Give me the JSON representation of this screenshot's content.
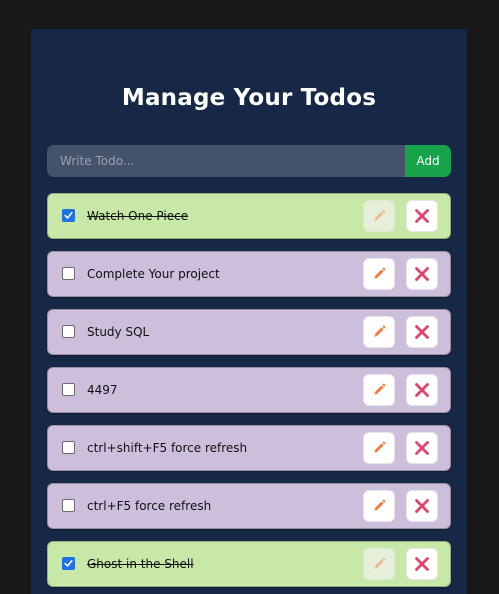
{
  "app": {
    "title": "Manage Your Todos"
  },
  "form": {
    "placeholder": "Write Todo...",
    "value": "",
    "add_label": "Add"
  },
  "colors": {
    "page_bg": "#181818",
    "panel_bg": "#172847",
    "input_bg": "#45526b",
    "add_button": "#16a34a",
    "pending_item": "#cdbfdb",
    "completed_item": "#c8e8a8",
    "edit_icon": "#f07a3a",
    "delete_icon": "#e0446a"
  },
  "icons": {
    "edit": "pencil-icon",
    "delete": "x-icon"
  },
  "todos": [
    {
      "text": "Watch One Piece",
      "completed": true
    },
    {
      "text": "Complete Your project",
      "completed": false
    },
    {
      "text": "Study SQL",
      "completed": false
    },
    {
      "text": "4497",
      "completed": false
    },
    {
      "text": "ctrl+shift+F5 force refresh",
      "completed": false
    },
    {
      "text": "ctrl+F5 force refresh",
      "completed": false
    },
    {
      "text": "Ghost in the Shell",
      "completed": true
    }
  ]
}
